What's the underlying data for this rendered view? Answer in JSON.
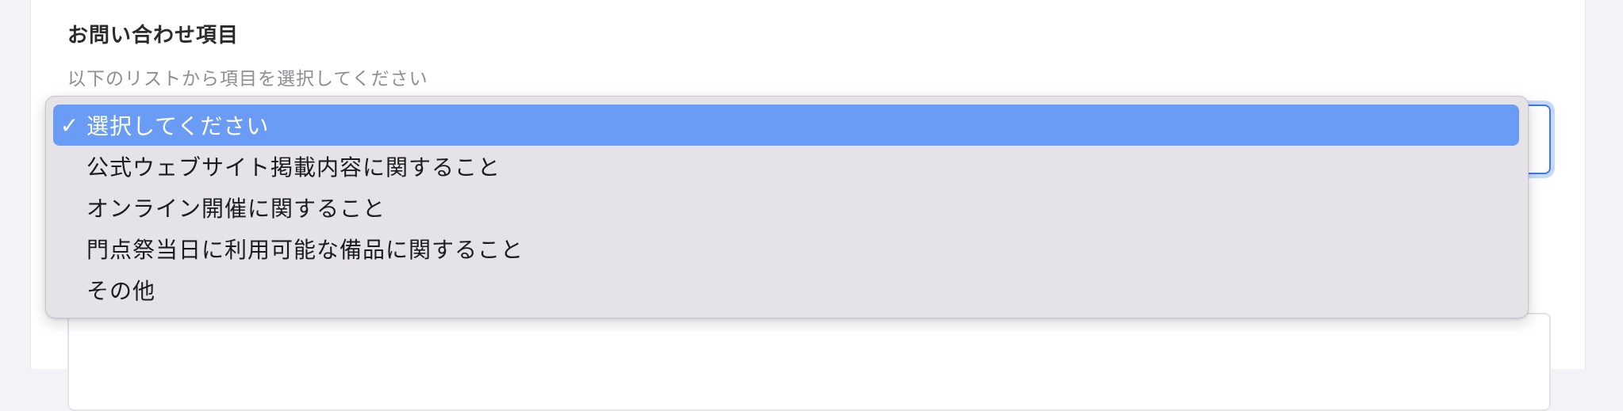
{
  "form": {
    "field_label": "お問い合わせ項目",
    "help_text": "以下のリストから項目を選択してください"
  },
  "dropdown": {
    "selected_index": 0,
    "check_icon": "✓",
    "options": [
      "選択してください",
      "公式ウェブサイト掲載内容に関すること",
      "オンライン開催に関すること",
      "門点祭当日に利用可能な備品に関すること",
      "その他"
    ]
  },
  "colors": {
    "selected_bg": "#6a9cf6",
    "focus_border": "#3b78f6",
    "menu_bg": "#e5e2e8"
  }
}
